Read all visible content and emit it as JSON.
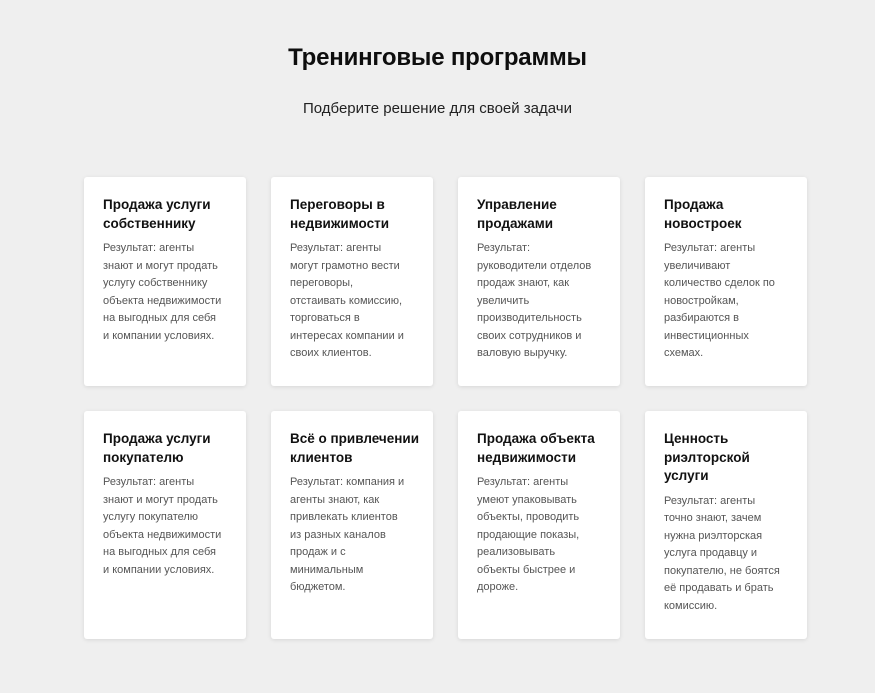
{
  "header": {
    "title": "Тренинговые программы",
    "subtitle": "Подберите решение для своей задачи"
  },
  "programs": [
    {
      "title_lines": [
        "Продажа услуги",
        "собственнику"
      ],
      "text_lines": [
        "Результат: агенты",
        "знают и могут продать",
        "услугу собственнику",
        "объекта недвижимости",
        "на выгодных для себя",
        "и компании условиях."
      ]
    },
    {
      "title_lines": [
        "Переговоры в",
        "недвижимости"
      ],
      "text_lines": [
        "Результат: агенты",
        "могут грамотно вести",
        "переговоры,",
        "отстаивать комиссию,",
        "торговаться в",
        "интересах компании и",
        "своих клиентов."
      ]
    },
    {
      "title_lines": [
        "Управление",
        "продажами"
      ],
      "text_lines": [
        "Результат:",
        "руководители отделов",
        "продаж знают, как",
        "увеличить",
        "производительность",
        "своих сотрудников и",
        "валовую выручку."
      ]
    },
    {
      "title_lines": [
        "Продажа",
        "новостроек"
      ],
      "text_lines": [
        "Результат: агенты",
        "увеличивают",
        "количество сделок по",
        "новостройкам,",
        "разбираются в",
        "инвестиционных",
        "схемах."
      ]
    },
    {
      "title_lines": [
        "Продажа услуги",
        "покупателю"
      ],
      "text_lines": [
        "Результат: агенты",
        "знают и могут продать",
        "услугу покупателю",
        "объекта недвижимости",
        "на выгодных для себя",
        "и компании условиях."
      ]
    },
    {
      "title_lines": [
        "Всё о привлечении",
        "клиентов"
      ],
      "text_lines": [
        "Результат: компания и",
        "агенты знают, как",
        "привлекать клиентов",
        "из разных каналов",
        "продаж и с",
        "минимальным",
        "бюджетом."
      ]
    },
    {
      "title_lines": [
        "Продажа объекта",
        "недвижимости"
      ],
      "text_lines": [
        "Результат: агенты",
        "умеют упаковывать",
        "объекты, проводить",
        "продающие показы,",
        "реализовывать",
        "объекты быстрее и",
        "дороже."
      ]
    },
    {
      "title_lines": [
        "Ценность",
        "риэлторской",
        "услуги"
      ],
      "text_lines": [
        "Результат: агенты",
        "точно знают, зачем",
        "нужна риэлторская",
        "услуга продавцу и",
        "покупателю, не боятся",
        "её продавать и брать",
        "комиссию."
      ]
    }
  ]
}
